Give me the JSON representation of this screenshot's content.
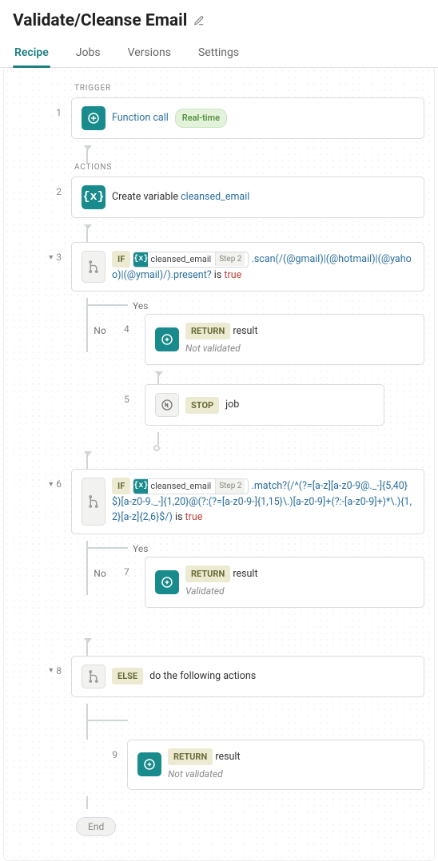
{
  "header": {
    "title": "Validate/Cleanse Email"
  },
  "tabs": {
    "recipe": "Recipe",
    "jobs": "Jobs",
    "versions": "Versions",
    "settings": "Settings"
  },
  "labels": {
    "trigger": "TRIGGER",
    "actions": "ACTIONS",
    "yes": "Yes",
    "no": "No",
    "end": "End"
  },
  "keywords": {
    "if": "IF",
    "else": "ELSE",
    "return": "RETURN",
    "stop": "STOP"
  },
  "badges": {
    "realtime": "Real-time"
  },
  "steps": {
    "1": {
      "num": "1",
      "text": "Function call"
    },
    "2": {
      "num": "2",
      "text_prefix": "Create variable ",
      "variable": "cleansed_email"
    },
    "3": {
      "num": "3",
      "pill_label": "cleansed_email",
      "pill_step": "Step 2",
      "code_a": ".scan(/(@gmail)|(@hotmail)|(@yahoo)|(@ymail)/).present?",
      "istrue_prefix": " is ",
      "istrue": "true"
    },
    "4": {
      "num": "4",
      "result": "result",
      "sub": "Not validated"
    },
    "5": {
      "num": "5",
      "job": "job"
    },
    "6": {
      "num": "6",
      "pill_label": "cleansed_email",
      "pill_step": "Step 2",
      "code_a": ".match?(/^(?=[a-z][a-z0-9@._-]{5,40}$)[a-z0-9._-]{1,20}@(?:(?=[a-z0-9-]{1,15}\\.)[a-z0-9]+(?:-[a-z0-9]+)*\\.){1,2}[a-z]{2,6}$/)",
      "istrue_prefix": " is ",
      "istrue": "true"
    },
    "7": {
      "num": "7",
      "result": "result",
      "sub": "Validated"
    },
    "8": {
      "num": "8",
      "text": "do the following actions"
    },
    "9": {
      "num": "9",
      "result": "result",
      "sub": "Not validated"
    }
  }
}
